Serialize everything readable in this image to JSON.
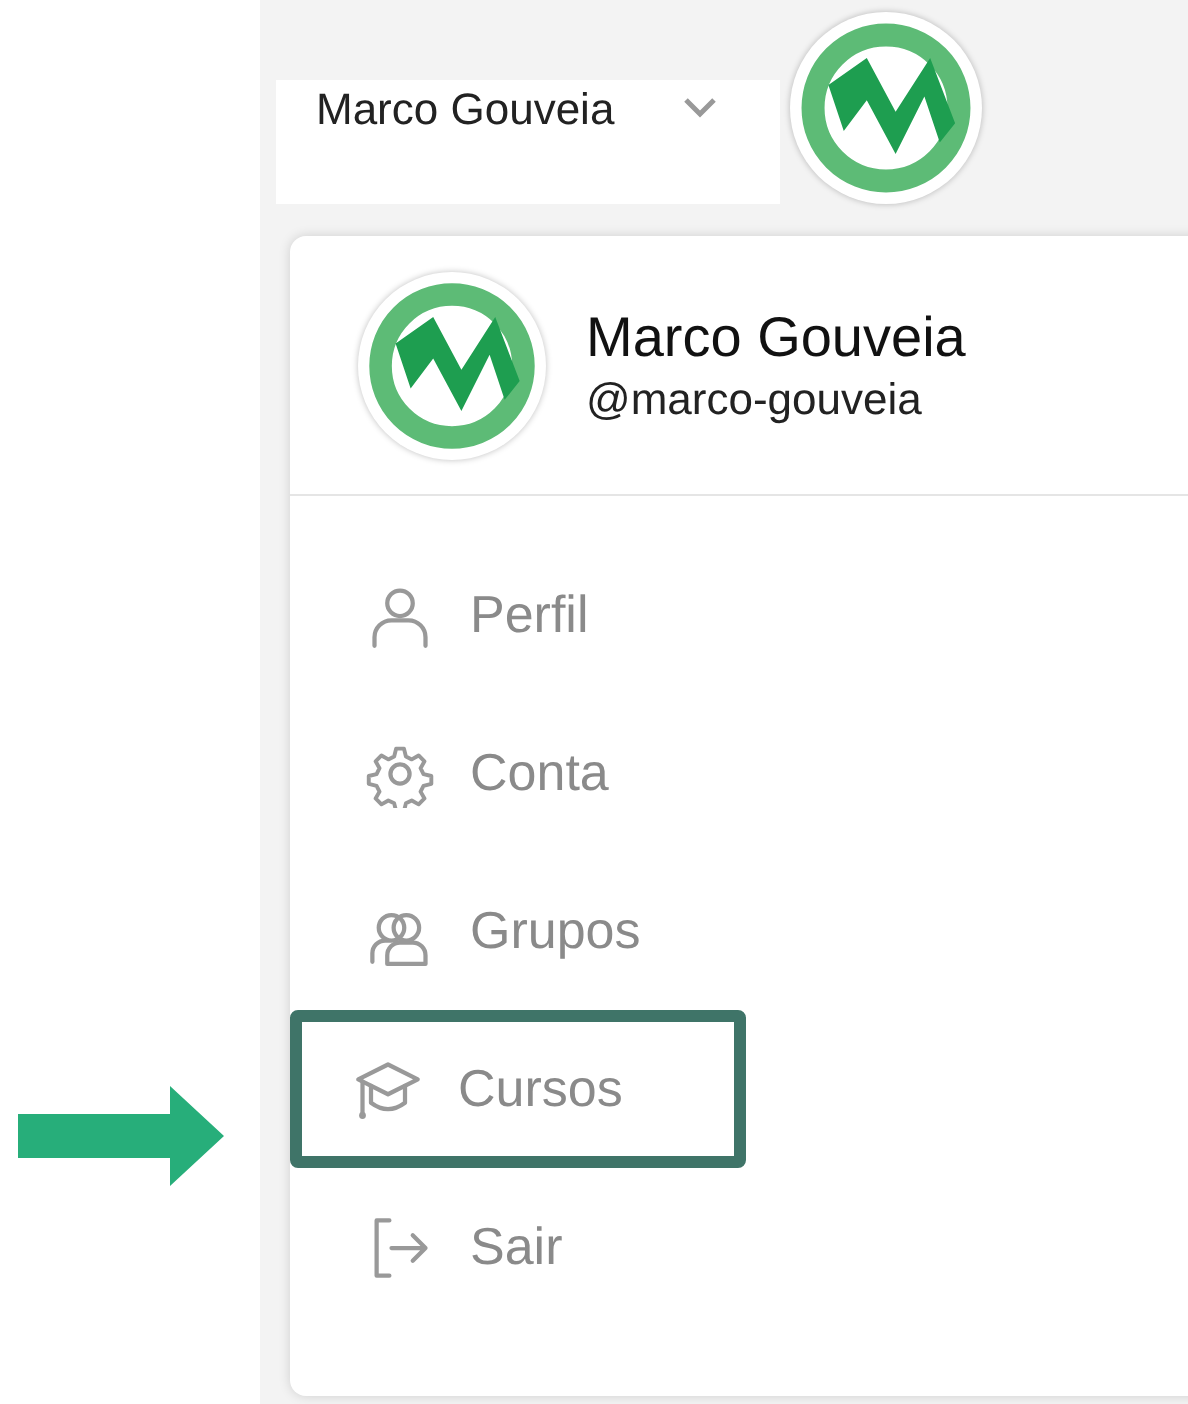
{
  "header": {
    "user_name": "Marco Gouveia"
  },
  "menu": {
    "name": "Marco Gouveia",
    "handle": "@marco-gouveia",
    "items": [
      {
        "kind": "person",
        "label": "Perfil",
        "highlighted": false
      },
      {
        "kind": "gear",
        "label": "Conta",
        "highlighted": false
      },
      {
        "kind": "group",
        "label": "Grupos",
        "highlighted": false
      },
      {
        "kind": "cap",
        "label": "Cursos",
        "highlighted": true
      },
      {
        "kind": "exit",
        "label": "Sair",
        "highlighted": false
      }
    ]
  }
}
